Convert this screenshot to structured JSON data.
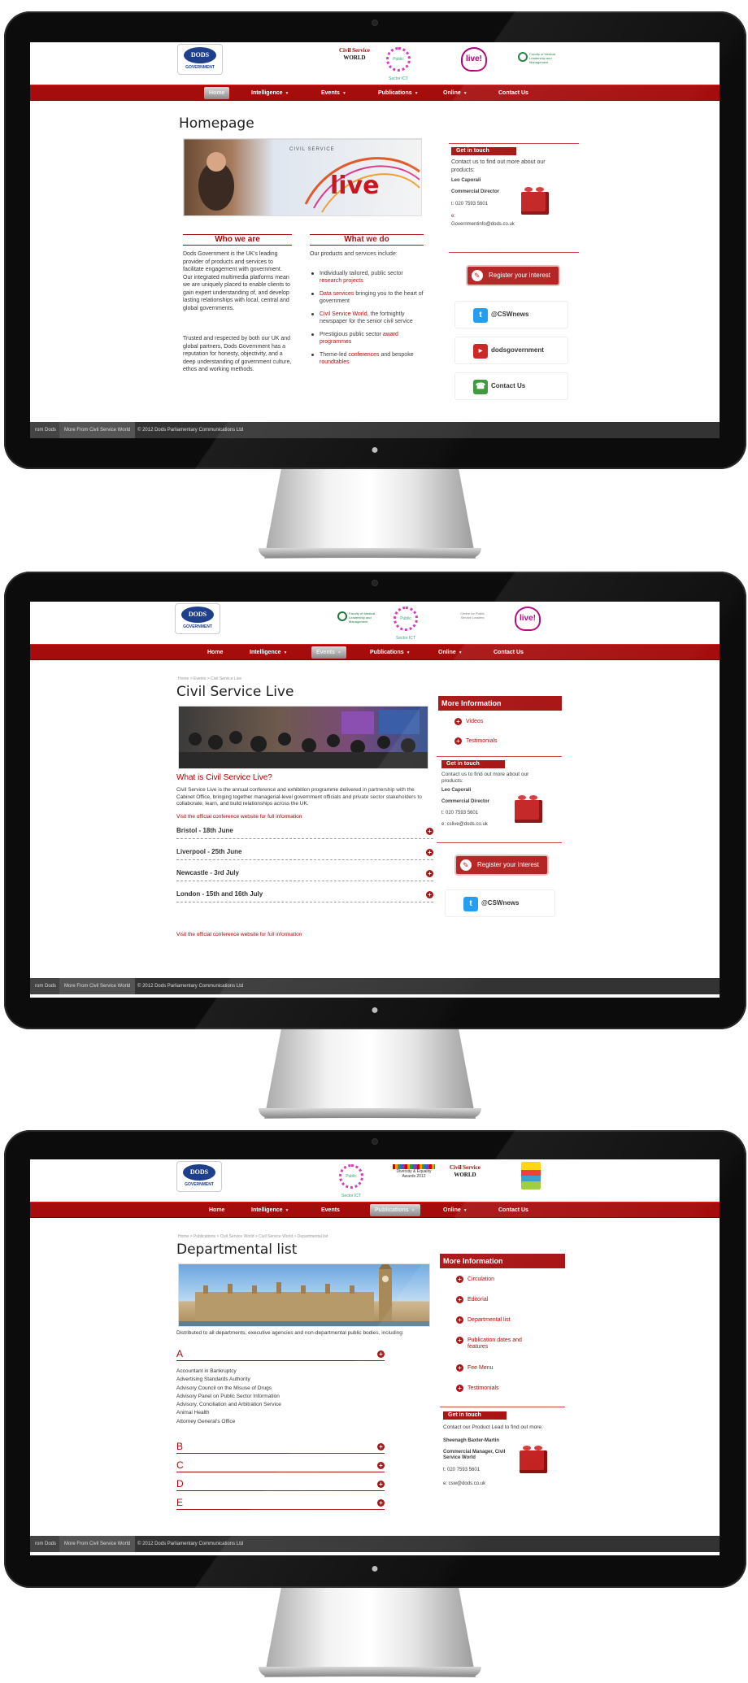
{
  "brand_logo": {
    "name": "DODS",
    "sub": "GOVERNMENT"
  },
  "brands": {
    "csw": {
      "line1": "Civil Service",
      "line2": "WORLD"
    },
    "psict": "Public Sector ICT",
    "live": "live!",
    "fmlm": "Faculty of Medical Leadership and Management",
    "ccp": "Centre for Public Service Leaders",
    "diversity": {
      "line1": "Diversity & Equality",
      "line2": "Awards 2012"
    }
  },
  "nav": {
    "home": "Home",
    "intelligence": "Intelligence",
    "events": "Events",
    "publications": "Publications",
    "online": "Online",
    "contact": "Contact Us"
  },
  "footer": {
    "from_dods": "rom Dods",
    "more_from": "More From Civil Service World",
    "copyright": "© 2012 Dods Parliamentary Communications Ltd"
  },
  "get_in_touch": "Get in touch",
  "register": "Register your interest",
  "social": {
    "twitter": "@CSWnews",
    "youtube": "dodsgovernment",
    "contact": "Contact Us"
  },
  "screen1": {
    "title": "Homepage",
    "hero_text": "live",
    "who_heading": "Who we are",
    "who_p1": "Dods Government is the UK's leading provider of products and services to facilitate engagement with government. Our integrated multimedia platforms mean we are uniquely placed to enable clients to gain expert understanding of, and develop lasting relationships with local, central and global governments.",
    "who_p2": "Trusted and respected by both our UK and global partners, Dods Government has a reputation for honesty, objectivity, and a deep understanding of government culture, ethos and working methods.",
    "what_heading": "What we do",
    "what_intro": "Our products and services include:",
    "what_items": [
      {
        "pre": "Individually tailored, public sector ",
        "link": "research projects",
        "post": ""
      },
      {
        "pre": "",
        "link": "Data services",
        "post": " bringing you to the heart of government"
      },
      {
        "pre": "",
        "link": "Civil Service World",
        "post": ", the fortnightly newspaper for the senior civil service"
      },
      {
        "pre": "Prestigious public sector ",
        "link": "award programmes",
        "post": ""
      },
      {
        "pre": "Theme-led ",
        "link": "conferences",
        "post": " and bespoke "
      },
      {
        "pre": "",
        "link": "roundtables",
        "post": ""
      }
    ],
    "contact_intro": "Contact us to find out more about our products:",
    "contact_name": "Leo Caporali",
    "contact_role": "Commercial Director",
    "contact_phone_label": "t:",
    "contact_phone": "020 7593 5601",
    "contact_email_label": "e:",
    "contact_email": "Governmentinfo@dods.co.uk"
  },
  "screen2": {
    "breadcrumb": "Home > Events > Civil Service Live",
    "title": "Civil Service Live",
    "subheading": "What is Civil Service Live?",
    "body": "Civil Service Live is the annual conference and exhibition programme delivered in partnership with the Cabinet Office, bringing together managerial-level government officials and private sector stakeholders to collaborate, learn, and build relationships across the UK.",
    "official_link": "Visit the official conference website for full information",
    "events": [
      "Bristol - 18th June",
      "Liverpool - 25th June",
      "Newcastle - 3rd July",
      "London - 15th and 16th July"
    ],
    "more_info": "More Information",
    "more_items": [
      "Videos",
      "Testimonials"
    ],
    "contact_intro": "Contact us to find out more about our products:",
    "contact_name": "Leo Caporali",
    "contact_role": "Commercial Director",
    "contact_phone": "t: 020 7593 5601",
    "contact_email": "e: cslive@dods.co.uk"
  },
  "screen3": {
    "breadcrumb": "Home > Publications > Civil Service World > Civil Service World > Departmental list",
    "title": "Departmental list",
    "intro": "Distributed to all departments, executive agencies and non-departmental public bodies, including:",
    "letter_a": "A",
    "a_items": [
      "Accountant in Bankruptcy",
      "Advertising Standards Authority",
      "Advisory Council on the Misuse of Drugs",
      "Advisory Panel on Public Sector Information",
      "Advisory, Conciliation and Arbitration Service",
      "Animal Health",
      "Attorney General's Office"
    ],
    "letters": [
      "B",
      "C",
      "D",
      "E"
    ],
    "more_info": "More Information",
    "more_items": [
      "Circulation",
      "Editorial",
      "Departmental list",
      "Publication dates and features",
      "Fee Menu",
      "Testimonials"
    ],
    "contact_intro": "Contact our Product Lead to find out more:",
    "contact_name": "Sheenagh Baxter-Martin",
    "contact_role": "Commercial Manager, Civil Service World",
    "contact_phone": "t: 020 7593 5601",
    "contact_email": "e: csw@dods.co.uk"
  },
  "colors": {
    "accent": "#a50d0d",
    "link": "#b30000",
    "twitter": "#1d9bf0",
    "youtube": "#cc2222",
    "phone": "#3a9a3a"
  }
}
